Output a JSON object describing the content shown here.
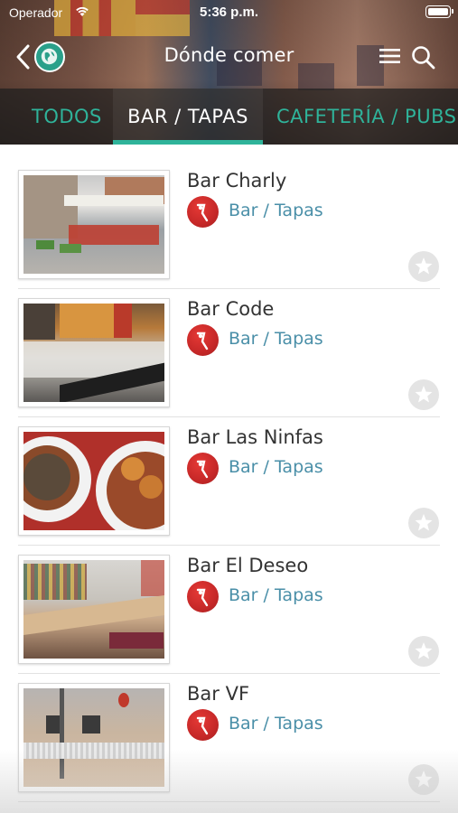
{
  "status_bar": {
    "carrier": "Operador",
    "time": "5:36 p.m.",
    "icons": [
      "wifi-icon",
      "battery-icon"
    ]
  },
  "nav": {
    "title": "Dónde comer",
    "icons": [
      "back-icon",
      "globe-icon",
      "menu-icon",
      "search-icon"
    ]
  },
  "tabs": [
    {
      "label": "TODOS",
      "active": false
    },
    {
      "label": "BAR / TAPAS",
      "active": true
    },
    {
      "label": "CAFETERÍA / PUBS",
      "active": false
    }
  ],
  "colors": {
    "accent": "#2fb39a",
    "category_text": "#4a8fa8",
    "category_icon": "#d32f2f"
  },
  "items": [
    {
      "name": "Bar Charly",
      "category": "Bar / Tapas",
      "favorite": false
    },
    {
      "name": "Bar Code",
      "category": "Bar / Tapas",
      "favorite": false
    },
    {
      "name": "Bar Las Ninfas",
      "category": "Bar / Tapas",
      "favorite": false
    },
    {
      "name": "Bar El Deseo",
      "category": "Bar / Tapas",
      "favorite": false
    },
    {
      "name": "Bar VF",
      "category": "Bar / Tapas",
      "favorite": false
    }
  ]
}
